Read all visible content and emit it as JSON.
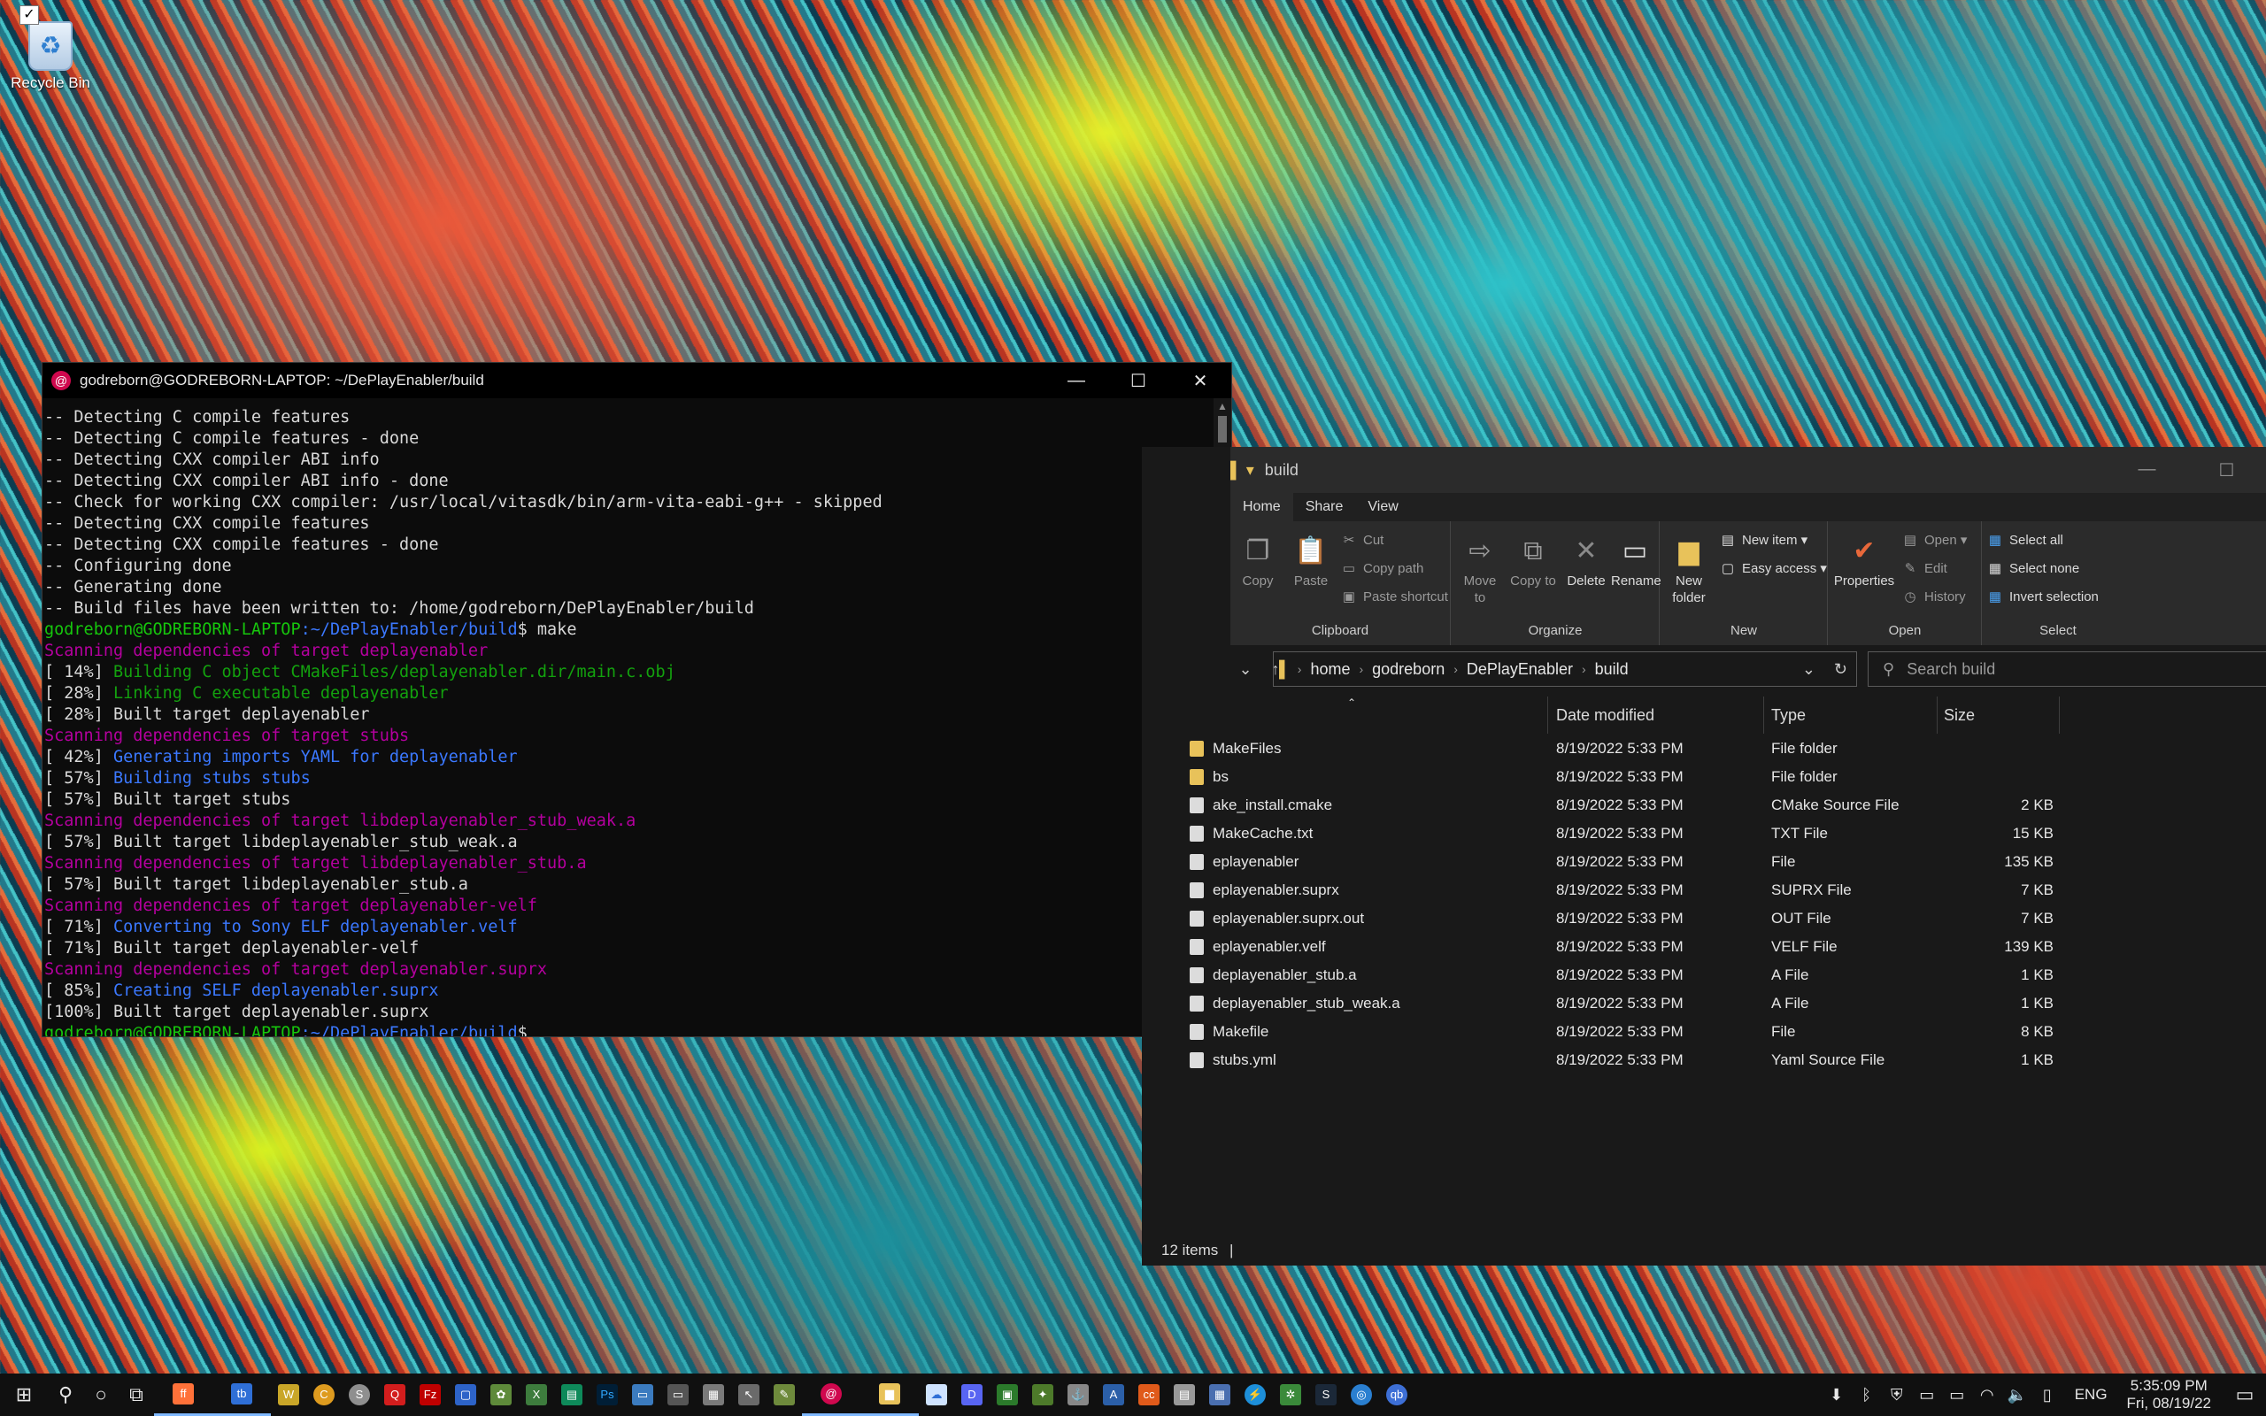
{
  "desktop": {
    "recycle_bin_label": "Recycle Bin"
  },
  "terminal": {
    "title": "godreborn@GODREBORN-LAPTOP: ~/DePlayEnabler/build",
    "controls": {
      "minimize": "—",
      "maximize": "☐",
      "close": "✕"
    },
    "lines": [
      {
        "text": "-- Detecting C compile features",
        "color": "white"
      },
      {
        "text": "-- Detecting C compile features - done",
        "color": "white"
      },
      {
        "text": "-- Detecting CXX compiler ABI info",
        "color": "white"
      },
      {
        "text": "-- Detecting CXX compiler ABI info - done",
        "color": "white"
      },
      {
        "text": "-- Check for working CXX compiler: /usr/local/vitasdk/bin/arm-vita-eabi-g++ - skipped",
        "color": "white"
      },
      {
        "text": "-- Detecting CXX compile features",
        "color": "white"
      },
      {
        "text": "-- Detecting CXX compile features - done",
        "color": "white"
      },
      {
        "text": "-- Configuring done",
        "color": "white"
      },
      {
        "text": "-- Generating done",
        "color": "white"
      },
      {
        "text": "-- Build files have been written to: /home/godreborn/DePlayEnabler/build",
        "color": "white"
      },
      {
        "prompt": true,
        "user": "godreborn@GODREBORN-LAPTOP",
        "path": ":~/DePlayEnabler/build",
        "cmd": "$ make"
      },
      {
        "text": "Scanning dependencies of target deplayenabler",
        "color": "mag"
      },
      {
        "pct": "[ 14%] ",
        "text": "Building C object CMakeFiles/deplayenabler.dir/main.c.obj",
        "color": "green"
      },
      {
        "pct": "[ 28%] ",
        "text": "Linking C executable deplayenabler",
        "color": "green"
      },
      {
        "text": "[ 28%] Built target deplayenabler",
        "color": "white"
      },
      {
        "text": "Scanning dependencies of target stubs",
        "color": "mag"
      },
      {
        "pct": "[ 42%] ",
        "text": "Generating imports YAML for deplayenabler",
        "color": "blue"
      },
      {
        "pct": "[ 57%] ",
        "text": "Building stubs stubs",
        "color": "blue"
      },
      {
        "text": "[ 57%] Built target stubs",
        "color": "white"
      },
      {
        "text": "Scanning dependencies of target libdeplayenabler_stub_weak.a",
        "color": "mag"
      },
      {
        "text": "[ 57%] Built target libdeplayenabler_stub_weak.a",
        "color": "white"
      },
      {
        "text": "Scanning dependencies of target libdeplayenabler_stub.a",
        "color": "mag"
      },
      {
        "text": "[ 57%] Built target libdeplayenabler_stub.a",
        "color": "white"
      },
      {
        "text": "Scanning dependencies of target deplayenabler-velf",
        "color": "mag"
      },
      {
        "pct": "[ 71%] ",
        "text": "Converting to Sony ELF deplayenabler.velf",
        "color": "blue"
      },
      {
        "text": "[ 71%] Built target deplayenabler-velf",
        "color": "white"
      },
      {
        "text": "Scanning dependencies of target deplayenabler.suprx",
        "color": "mag"
      },
      {
        "pct": "[ 85%] ",
        "text": "Creating SELF deplayenabler.suprx",
        "color": "blue"
      },
      {
        "text": "[100%] Built target deplayenabler.suprx",
        "color": "white"
      },
      {
        "prompt": true,
        "user": "godreborn@GODREBORN-LAPTOP",
        "path": ":~/DePlayEnabler/build",
        "cmd": "$"
      }
    ]
  },
  "explorer": {
    "title": "build",
    "tabs": [
      "Home",
      "Share",
      "View"
    ],
    "ribbon": {
      "clipboard": {
        "group": "Clipboard",
        "copy": "Copy",
        "paste": "Paste",
        "cut": "Cut",
        "copy_path": "Copy path",
        "paste_shortcut": "Paste shortcut"
      },
      "organize": {
        "group": "Organize",
        "move_to": "Move to",
        "copy_to": "Copy to",
        "delete": "Delete",
        "rename": "Rename"
      },
      "new": {
        "group": "New",
        "new_folder": "New folder",
        "new_item": "New item",
        "easy_access": "Easy access"
      },
      "open": {
        "group": "Open",
        "properties": "Properties",
        "open": "Open",
        "edit": "Edit",
        "history": "History"
      },
      "select": {
        "group": "Select",
        "select_all": "Select all",
        "select_none": "Select none",
        "invert_selection": "Invert selection"
      }
    },
    "breadcrumb": [
      "home",
      "godreborn",
      "DePlayEnabler",
      "build"
    ],
    "search_placeholder": "Search build",
    "columns": {
      "date": "Date modified",
      "type": "Type",
      "size": "Size"
    },
    "files": [
      {
        "name": "MakeFiles",
        "date": "8/19/2022 5:33 PM",
        "type": "File folder",
        "size": ""
      },
      {
        "name": "bs",
        "date": "8/19/2022 5:33 PM",
        "type": "File folder",
        "size": ""
      },
      {
        "name": "ake_install.cmake",
        "date": "8/19/2022 5:33 PM",
        "type": "CMake Source File",
        "size": "2 KB"
      },
      {
        "name": "MakeCache.txt",
        "date": "8/19/2022 5:33 PM",
        "type": "TXT File",
        "size": "15 KB"
      },
      {
        "name": "eplayenabler",
        "date": "8/19/2022 5:33 PM",
        "type": "File",
        "size": "135 KB"
      },
      {
        "name": "eplayenabler.suprx",
        "date": "8/19/2022 5:33 PM",
        "type": "SUPRX File",
        "size": "7 KB"
      },
      {
        "name": "eplayenabler.suprx.out",
        "date": "8/19/2022 5:33 PM",
        "type": "OUT File",
        "size": "7 KB"
      },
      {
        "name": "eplayenabler.velf",
        "date": "8/19/2022 5:33 PM",
        "type": "VELF File",
        "size": "139 KB"
      },
      {
        "name": "deplayenabler_stub.a",
        "date": "8/19/2022 5:33 PM",
        "type": "A File",
        "size": "1 KB"
      },
      {
        "name": "deplayenabler_stub_weak.a",
        "date": "8/19/2022 5:33 PM",
        "type": "A File",
        "size": "1 KB"
      },
      {
        "name": "Makefile",
        "date": "8/19/2022 5:33 PM",
        "type": "File",
        "size": "8 KB"
      },
      {
        "name": "stubs.yml",
        "date": "8/19/2022 5:33 PM",
        "type": "Yaml Source File",
        "size": "1 KB"
      }
    ],
    "status": "12 items"
  },
  "taskbar": {
    "lang": "ENG",
    "time": "5:35:09 PM",
    "date": "Fri, 08/19/22",
    "apps": [
      "firefox-icon",
      "thunderbird-icon",
      "winscp-icon",
      "chrome-icon",
      "safari-icon",
      "filezilla-icon",
      "terminal-icon",
      "explorer-icon",
      "onedrive-icon",
      "discord-icon",
      "steam-icon"
    ]
  }
}
